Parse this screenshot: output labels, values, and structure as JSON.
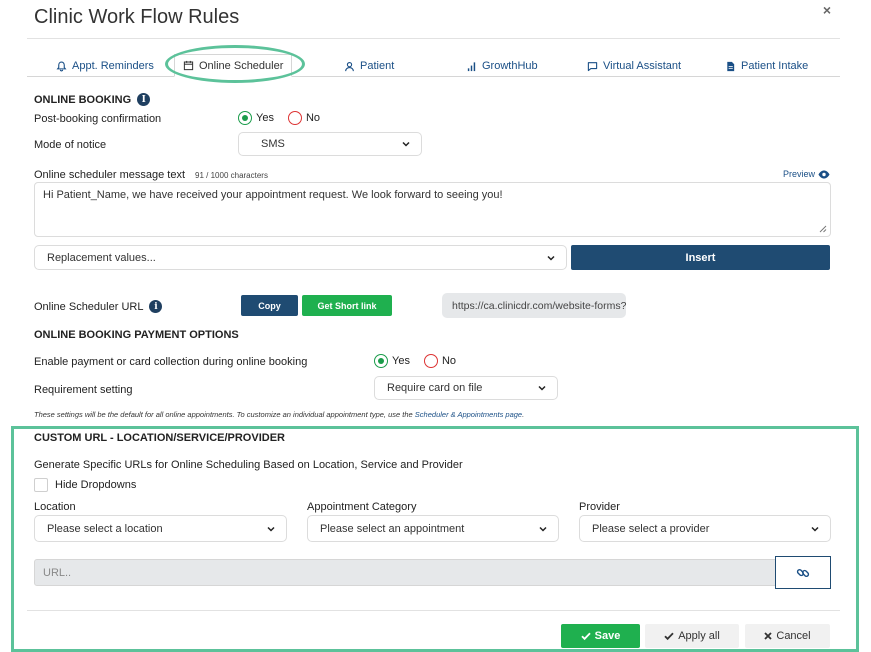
{
  "dialog": {
    "title": "Clinic Work Flow Rules",
    "close_glyph": "×"
  },
  "tabs": [
    {
      "label": "Appt. Reminders",
      "icon": "bell-icon"
    },
    {
      "label": "Online Scheduler",
      "icon": "calendar-icon",
      "active": true
    },
    {
      "label": "Patient",
      "icon": "user-icon"
    },
    {
      "label": "GrowthHub",
      "icon": "bar-chart-icon"
    },
    {
      "label": "Virtual Assistant",
      "icon": "chat-icon"
    },
    {
      "label": "Patient Intake",
      "icon": "document-icon"
    }
  ],
  "online_booking": {
    "heading": "ONLINE BOOKING",
    "post_booking_label": "Post-booking confirmation",
    "yes": "Yes",
    "no": "No",
    "post_booking_value": "Yes",
    "mode_label": "Mode of notice",
    "mode_value": "SMS",
    "message_label": "Online scheduler message text",
    "char_count": "91 / 1000 characters",
    "preview": "Preview",
    "message_text": "Hi Patient_Name, we have received your appointment request.  We look forward to seeing you!",
    "replacement_placeholder": "Replacement values...",
    "insert": "Insert",
    "url_label": "Online Scheduler URL",
    "copy": "Copy",
    "short_link": "Get Short link",
    "url_value": "https://ca.clinicdr.com/website-forms?"
  },
  "payment": {
    "heading": "ONLINE BOOKING PAYMENT OPTIONS",
    "enable_label": "Enable payment or card collection during online booking",
    "yes": "Yes",
    "no": "No",
    "enable_value": "Yes",
    "requirement_label": "Requirement setting",
    "requirement_value": "Require card on file",
    "note_prefix": "These settings will be the default for all online appointments. To customize an individual appointment type, use the ",
    "note_link": "Scheduler & Appointments page",
    "note_suffix": "."
  },
  "custom_url": {
    "heading": "CUSTOM URL - LOCATION/SERVICE/PROVIDER",
    "description": "Generate Specific URLs for Online Scheduling Based on Location, Service and Provider",
    "hide_dropdowns": "Hide Dropdowns",
    "location_label": "Location",
    "location_placeholder": "Please select a location",
    "category_label": "Appointment Category",
    "category_placeholder": "Please select an appointment",
    "provider_label": "Provider",
    "provider_placeholder": "Please select a provider",
    "url_placeholder": "URL.."
  },
  "footer": {
    "save": "Save",
    "apply_all": "Apply all",
    "cancel": "Cancel"
  },
  "colors": {
    "primary": "#1f4b72",
    "success": "#1fb04f",
    "highlight": "#5cc29a",
    "link": "#1a4f86"
  }
}
